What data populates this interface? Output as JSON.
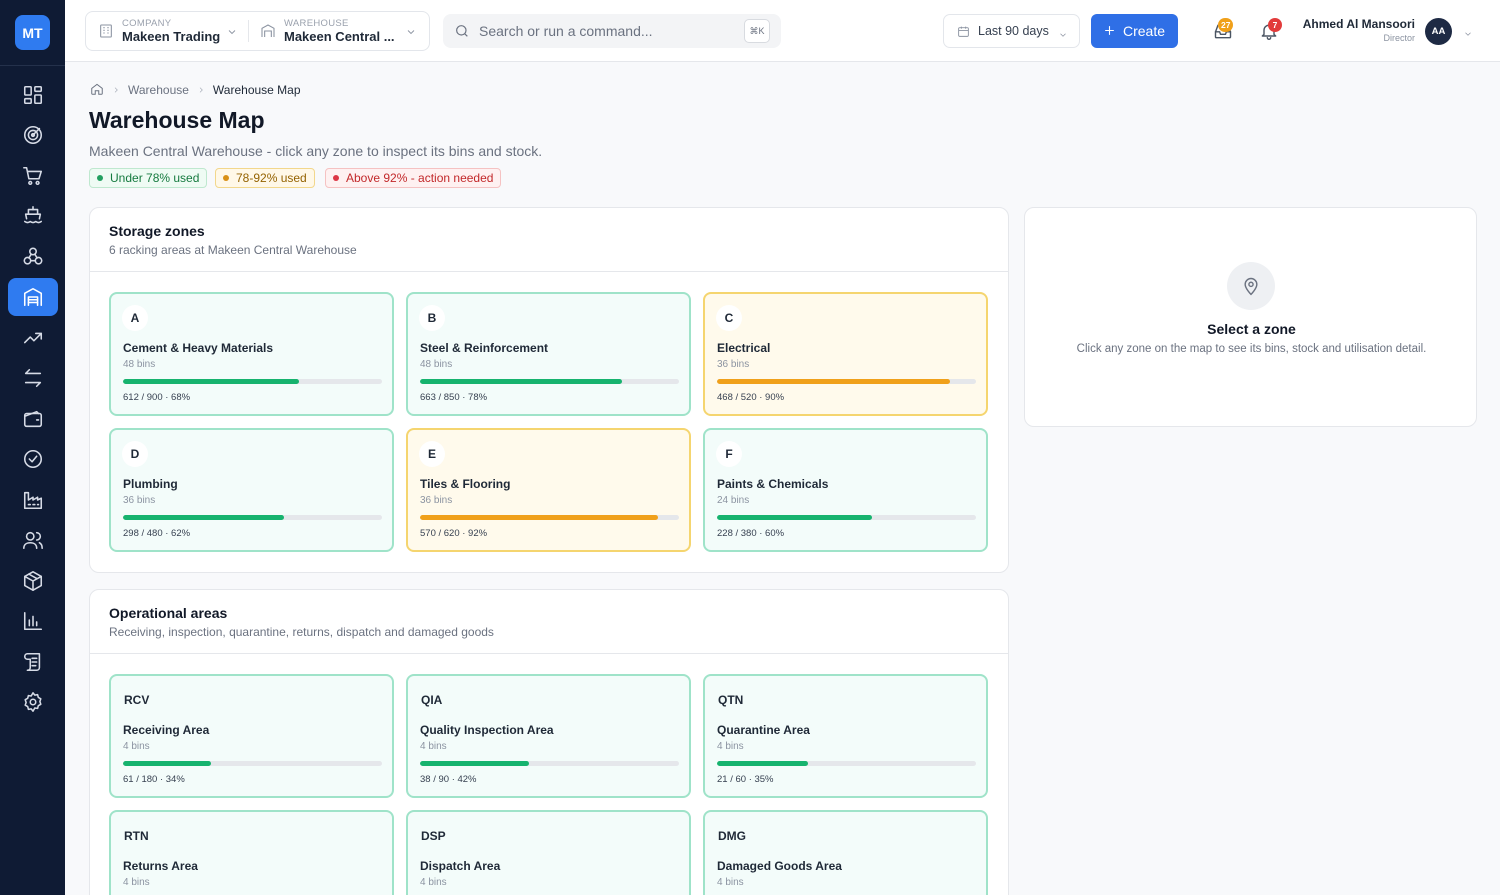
{
  "app": {
    "logo_text": "MT"
  },
  "header": {
    "company": {
      "small": "COMPANY",
      "name": "Makeen Trading"
    },
    "warehouse": {
      "small": "WAREHOUSE",
      "name": "Makeen Central ..."
    },
    "search": {
      "placeholder": "Search or run a command...",
      "shortcut": "⌘K"
    },
    "date_range": "Last 90 days",
    "create_label": "Create",
    "inbox_count": "27",
    "notifications_count": "7",
    "user": {
      "name": "Ahmed Al Mansoori",
      "role": "Director",
      "initials": "AA"
    }
  },
  "sidebar": {
    "items": [
      {
        "name": "dashboard",
        "icon": "grid-icon"
      },
      {
        "name": "targets",
        "icon": "target-icon"
      },
      {
        "name": "purchasing",
        "icon": "cart-icon"
      },
      {
        "name": "shipping",
        "icon": "ship-icon"
      },
      {
        "name": "hierarchy",
        "icon": "boxes-icon"
      },
      {
        "name": "warehouse",
        "icon": "warehouse-icon",
        "active": true
      },
      {
        "name": "analytics",
        "icon": "trend-icon"
      },
      {
        "name": "transfers",
        "icon": "arrows-icon"
      },
      {
        "name": "wallet",
        "icon": "wallet-icon"
      },
      {
        "name": "approvals",
        "icon": "check-circle-icon"
      },
      {
        "name": "factory",
        "icon": "factory-icon"
      },
      {
        "name": "users",
        "icon": "users-icon"
      },
      {
        "name": "products",
        "icon": "package-icon"
      },
      {
        "name": "reports",
        "icon": "bar-chart-icon"
      },
      {
        "name": "documents",
        "icon": "scroll-icon"
      },
      {
        "name": "settings",
        "icon": "gear-icon"
      }
    ]
  },
  "breadcrumb": {
    "parent": "Warehouse",
    "current": "Warehouse Map"
  },
  "page": {
    "title": "Warehouse Map",
    "subtitle": "Makeen Central Warehouse - click any zone to inspect its bins and stock."
  },
  "legend": {
    "green": "Under 78% used",
    "amber": "78-92% used",
    "red": "Above 92% - action needed"
  },
  "storage": {
    "title": "Storage zones",
    "subtitle": "6 racking areas at Makeen Central Warehouse",
    "zones": [
      {
        "code": "A",
        "name": "Cement & Heavy Materials",
        "bins": "48 bins",
        "stat": "612 / 900 · 68%",
        "pct": 68,
        "status": "ok"
      },
      {
        "code": "B",
        "name": "Steel & Reinforcement",
        "bins": "48 bins",
        "stat": "663 / 850 · 78%",
        "pct": 78,
        "status": "ok"
      },
      {
        "code": "C",
        "name": "Electrical",
        "bins": "36 bins",
        "stat": "468 / 520 · 90%",
        "pct": 90,
        "status": "warn"
      },
      {
        "code": "D",
        "name": "Plumbing",
        "bins": "36 bins",
        "stat": "298 / 480 · 62%",
        "pct": 62,
        "status": "ok"
      },
      {
        "code": "E",
        "name": "Tiles & Flooring",
        "bins": "36 bins",
        "stat": "570 / 620 · 92%",
        "pct": 92,
        "status": "warn"
      },
      {
        "code": "F",
        "name": "Paints & Chemicals",
        "bins": "24 bins",
        "stat": "228 / 380 · 60%",
        "pct": 60,
        "status": "ok"
      }
    ]
  },
  "operational": {
    "title": "Operational areas",
    "subtitle": "Receiving, inspection, quarantine, returns, dispatch and damaged goods",
    "zones": [
      {
        "code": "RCV",
        "name": "Receiving Area",
        "bins": "4 bins",
        "stat": "61 / 180 · 34%",
        "pct": 34,
        "status": "ok"
      },
      {
        "code": "QIA",
        "name": "Quality Inspection Area",
        "bins": "4 bins",
        "stat": "38 / 90 · 42%",
        "pct": 42,
        "status": "ok"
      },
      {
        "code": "QTN",
        "name": "Quarantine Area",
        "bins": "4 bins",
        "stat": "21 / 60 · 35%",
        "pct": 35,
        "status": "ok"
      },
      {
        "code": "RTN",
        "name": "Returns Area",
        "bins": "4 bins",
        "stat": "",
        "pct": null,
        "status": "ok"
      },
      {
        "code": "DSP",
        "name": "Dispatch Area",
        "bins": "4 bins",
        "stat": "",
        "pct": null,
        "status": "ok"
      },
      {
        "code": "DMG",
        "name": "Damaged Goods Area",
        "bins": "4 bins",
        "stat": "",
        "pct": null,
        "status": "ok"
      }
    ]
  },
  "detail": {
    "title": "Select a zone",
    "description": "Click any zone on the map to see its bins, stock and utilisation detail."
  }
}
